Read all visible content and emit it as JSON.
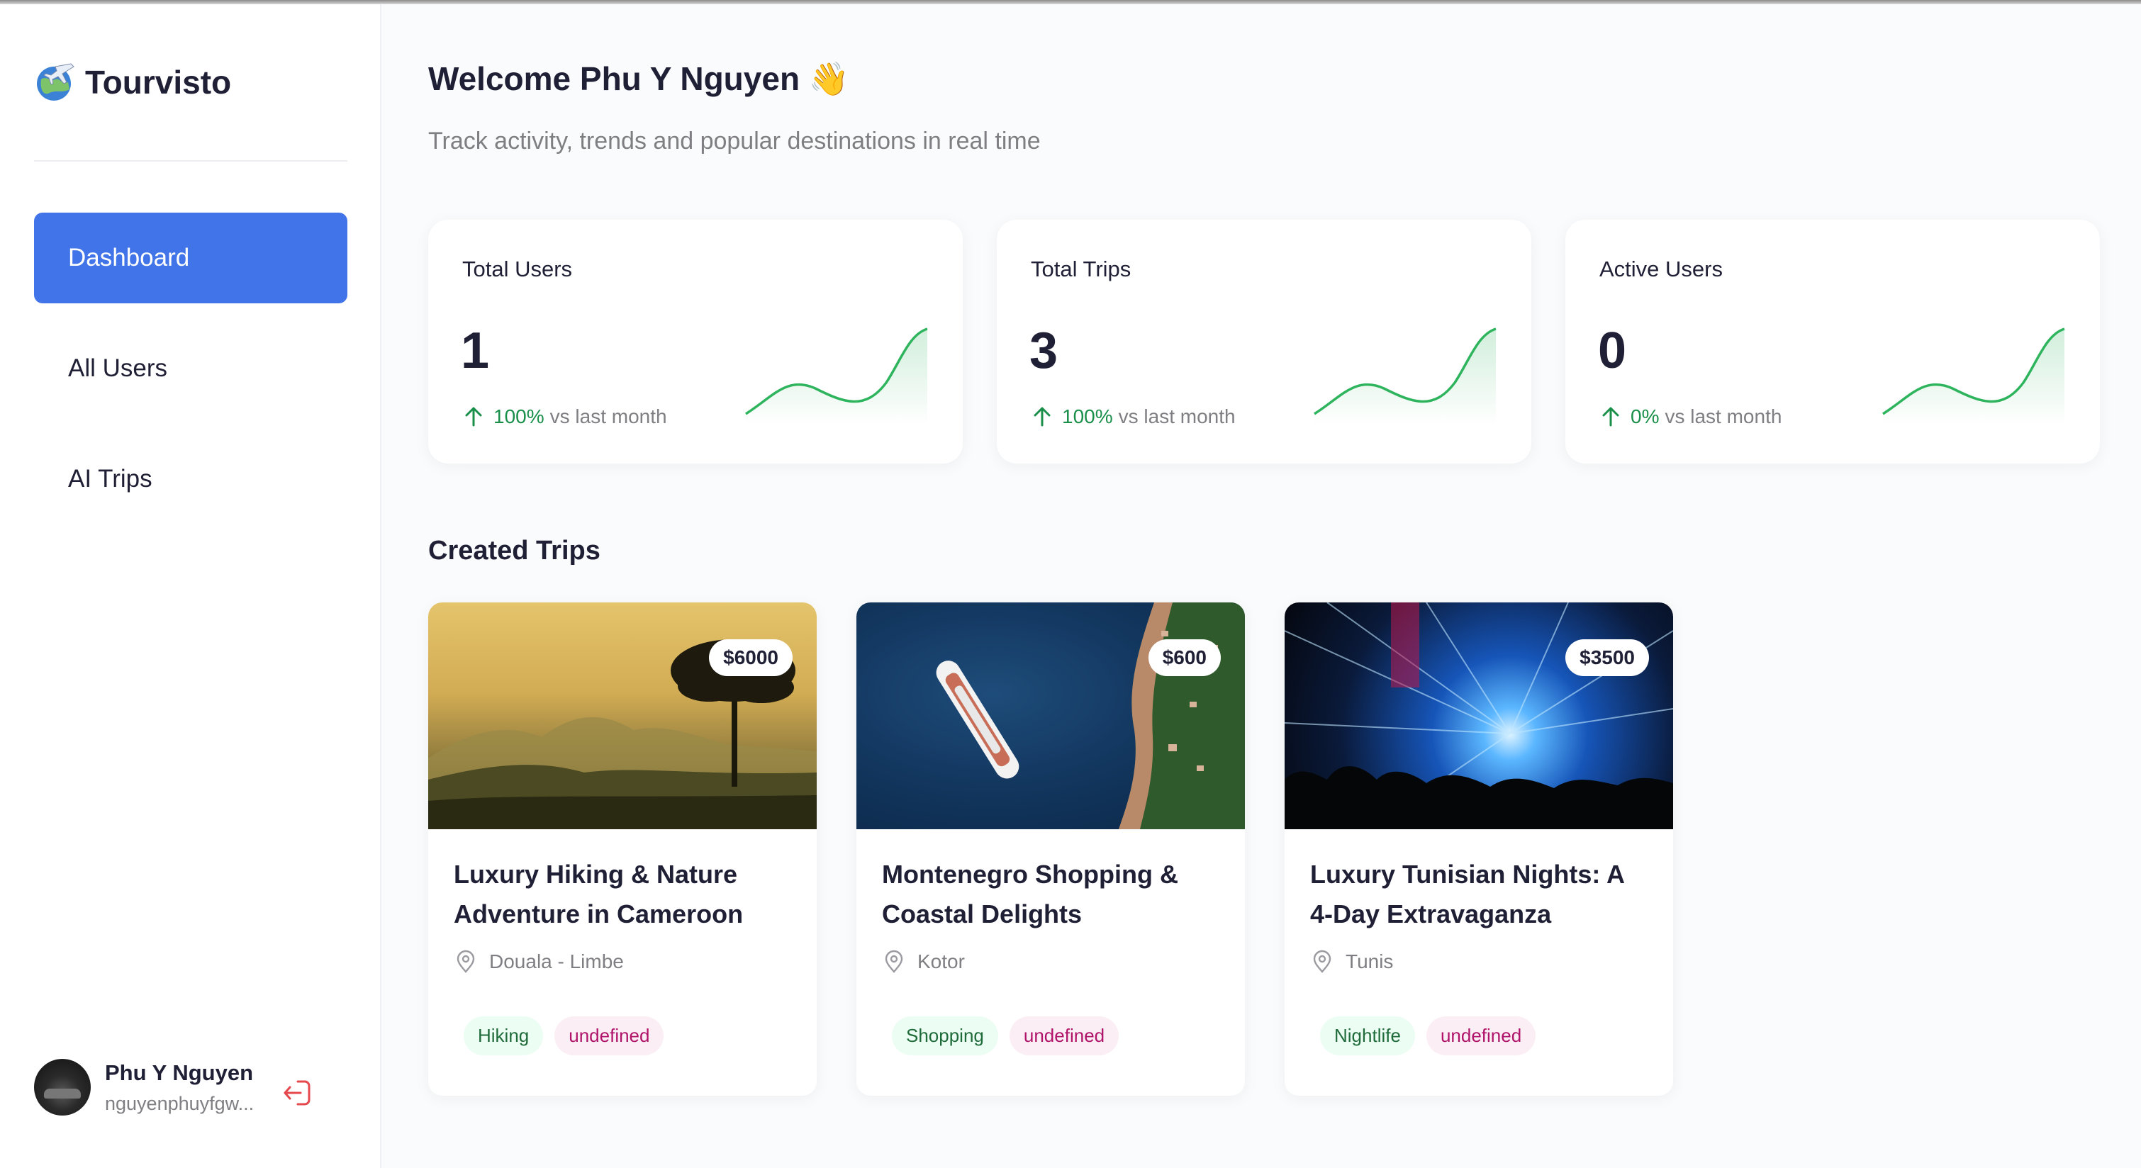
{
  "app": {
    "name": "Tourvisto"
  },
  "sidebar": {
    "items": [
      {
        "label": "Dashboard",
        "active": true
      },
      {
        "label": "All Users",
        "active": false
      },
      {
        "label": "AI Trips",
        "active": false
      }
    ],
    "user": {
      "name": "Phu Y Nguyen",
      "email": "nguyenphuyfgw..."
    }
  },
  "header": {
    "welcome": "Welcome Phu Y Nguyen 👋",
    "subtitle": "Track activity, trends and popular destinations in real time"
  },
  "stats": [
    {
      "label": "Total Users",
      "value": "1",
      "change": "100%",
      "suffix": "vs last month",
      "trend": "up"
    },
    {
      "label": "Total Trips",
      "value": "3",
      "change": "100%",
      "suffix": "vs last month",
      "trend": "up"
    },
    {
      "label": "Active Users",
      "value": "0",
      "change": "0%",
      "suffix": "vs last month",
      "trend": "up"
    }
  ],
  "trips_section": {
    "title": "Created Trips"
  },
  "trips": [
    {
      "price": "$6000",
      "title": "Luxury Hiking & Nature Adventure in Cameroon",
      "location": "Douala - Limbe",
      "tags": [
        "Hiking",
        "undefined"
      ]
    },
    {
      "price": "$600",
      "title": "Montenegro Shopping & Coastal Delights",
      "location": "Kotor",
      "tags": [
        "Shopping",
        "undefined"
      ]
    },
    {
      "price": "$3500",
      "title": "Luxury Tunisian Nights: A 4-Day Extravaganza",
      "location": "Tunis",
      "tags": [
        "Nightlife",
        "undefined"
      ]
    }
  ],
  "colors": {
    "primary": "#4174e8",
    "trend_green": "#1a8f4a",
    "sparkline": "#2fb45e",
    "tag_green_bg": "#ecfdf3",
    "tag_pink_bg": "#fbeef4",
    "logout_red": "#e5484d"
  },
  "icons": {
    "brand": "globe-plane-icon",
    "trend": "arrow-up-icon",
    "location": "map-pin-icon",
    "logout": "logout-icon"
  }
}
